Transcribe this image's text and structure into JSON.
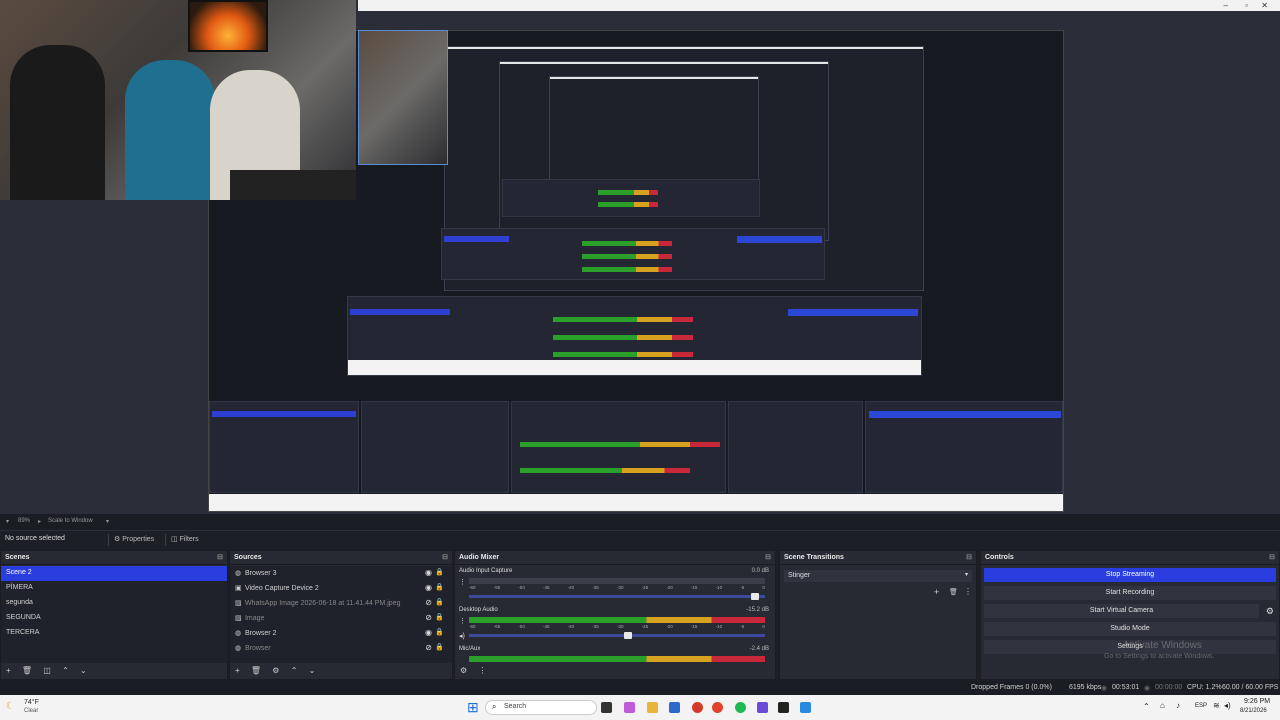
{
  "preview": {
    "toolbar": {
      "zoom": "89%",
      "scale": "Scale to Window"
    }
  },
  "context_bar": {
    "no_source": "No source selected",
    "properties": "Properties",
    "filters": "Filters"
  },
  "scenes": {
    "title": "Scenes",
    "items": [
      "Scene 2",
      "PÍMERA",
      "segunda",
      "SEGUNDA",
      "TERCERA"
    ],
    "selected": 0
  },
  "sources": {
    "title": "Sources",
    "items": [
      {
        "label": "Browser 3",
        "icon": "globe",
        "visible": true
      },
      {
        "label": "Video Capture Device 2",
        "icon": "camera",
        "visible": true
      },
      {
        "label": "WhatsApp Image 2026-06-18 at 11.41.44 PM.jpeg",
        "icon": "image",
        "visible": false
      },
      {
        "label": "Image",
        "icon": "image",
        "visible": false
      },
      {
        "label": "Browser 2",
        "icon": "globe",
        "visible": true
      },
      {
        "label": "Browser",
        "icon": "globe",
        "visible": false
      }
    ]
  },
  "audio_mixer": {
    "title": "Audio Mixer",
    "tracks": [
      {
        "name": "Audio Input Capture",
        "db": "0.0 dB",
        "level": 0.0,
        "volume": 0.98
      },
      {
        "name": "Desktop Audio",
        "db": "-15.2 dB",
        "level": 1.0,
        "volume": 0.55
      },
      {
        "name": "Mic/Aux",
        "db": "-2.4 dB",
        "level": 1.0,
        "volume": 0.0
      }
    ],
    "ticks": [
      "-60",
      "-55",
      "-50",
      "-45",
      "-40",
      "-35",
      "-30",
      "-25",
      "-20",
      "-15",
      "-10",
      "-5",
      "0"
    ]
  },
  "transitions": {
    "title": "Scene Transitions",
    "selected": "Stinger"
  },
  "controls": {
    "title": "Controls",
    "stop_streaming": "Stop Streaming",
    "start_recording": "Start Recording",
    "start_virtual_camera": "Start Virtual Camera",
    "studio_mode": "Studio Mode",
    "settings": "Settings"
  },
  "watermark": {
    "line1": "Activate Windows",
    "line2": "Go to Settings to activate Windows."
  },
  "status": {
    "dropped": "Dropped Frames 0 (0.0%)",
    "bitrate": "6195 kbps",
    "live_time": "00:53:01",
    "rec_time": "00:00:00",
    "cpu": "CPU: 1.2%",
    "fps": "60.00 / 60.00 FPS"
  },
  "taskbar": {
    "weather_temp": "74°F",
    "weather_desc": "Clear",
    "search": "Search",
    "lang": "ESP",
    "time": "9:26 PM",
    "date": "8/21/2026"
  }
}
